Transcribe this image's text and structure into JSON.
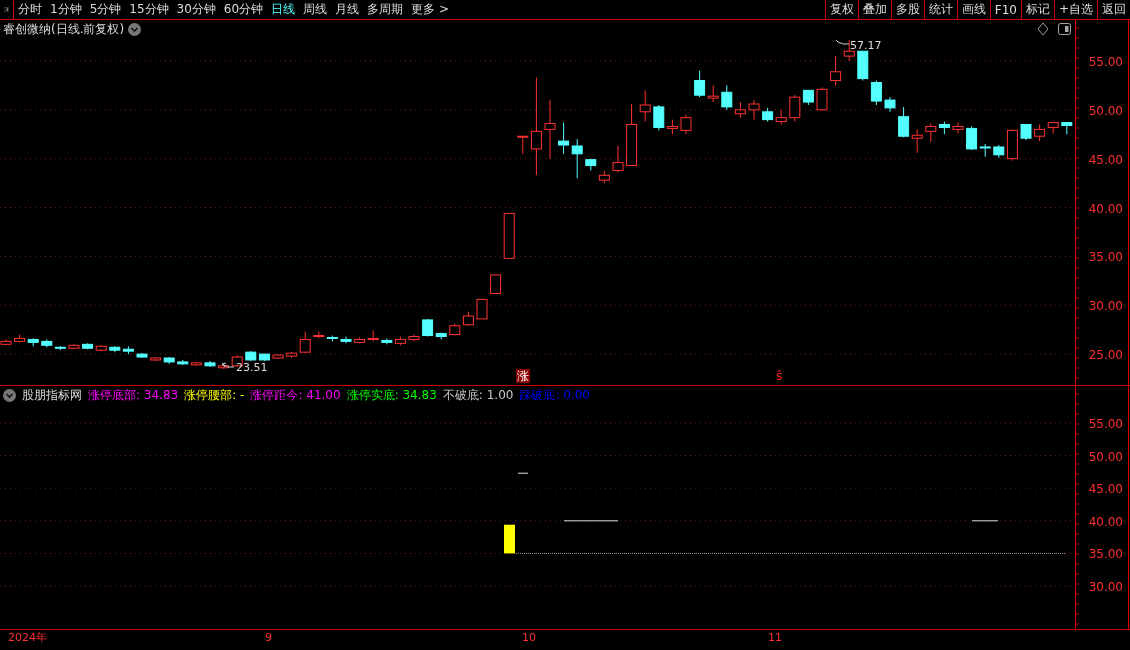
{
  "toolbar": {
    "tabs": [
      {
        "label": "分时",
        "selected": false
      },
      {
        "label": "1分钟",
        "selected": false
      },
      {
        "label": "5分钟",
        "selected": false
      },
      {
        "label": "15分钟",
        "selected": false
      },
      {
        "label": "30分钟",
        "selected": false
      },
      {
        "label": "60分钟",
        "selected": false
      },
      {
        "label": "日线",
        "selected": true
      },
      {
        "label": "周线",
        "selected": false
      },
      {
        "label": "月线",
        "selected": false
      },
      {
        "label": "多周期",
        "selected": false
      },
      {
        "label": "更多 >",
        "selected": false
      }
    ],
    "buttons": [
      "复权",
      "叠加",
      "多股",
      "统计",
      "画线",
      "F10",
      "标记",
      "+自选",
      "返回"
    ]
  },
  "main": {
    "title": "睿创微纳(日线.前复权)",
    "axis": [
      "55.00",
      "50.00",
      "45.00",
      "40.00",
      "35.00",
      "30.00",
      "25.00"
    ],
    "high_label": "57.17",
    "low_label": "23.51",
    "markers": [
      "涨",
      "ŝ"
    ]
  },
  "indicator": {
    "name": "股朋指标网",
    "items": [
      {
        "label": "涨停底部: 34.83",
        "color": "#ff00ff"
      },
      {
        "label": "涨停腰部: -",
        "color": "#ffff00"
      },
      {
        "label": "涨停距今: 41.00",
        "color": "#ff00ff"
      },
      {
        "label": "涨停实底: 34.83",
        "color": "#00ff00"
      },
      {
        "label": "不破底: 1.00",
        "color": "#c8c8c8"
      },
      {
        "label": "踩破底: 0.00",
        "color": "#0000ff"
      }
    ],
    "axis": [
      "55.00",
      "50.00",
      "45.00",
      "40.00",
      "35.00",
      "30.00"
    ]
  },
  "dates": [
    "2024年",
    "9",
    "10",
    "11"
  ]
}
